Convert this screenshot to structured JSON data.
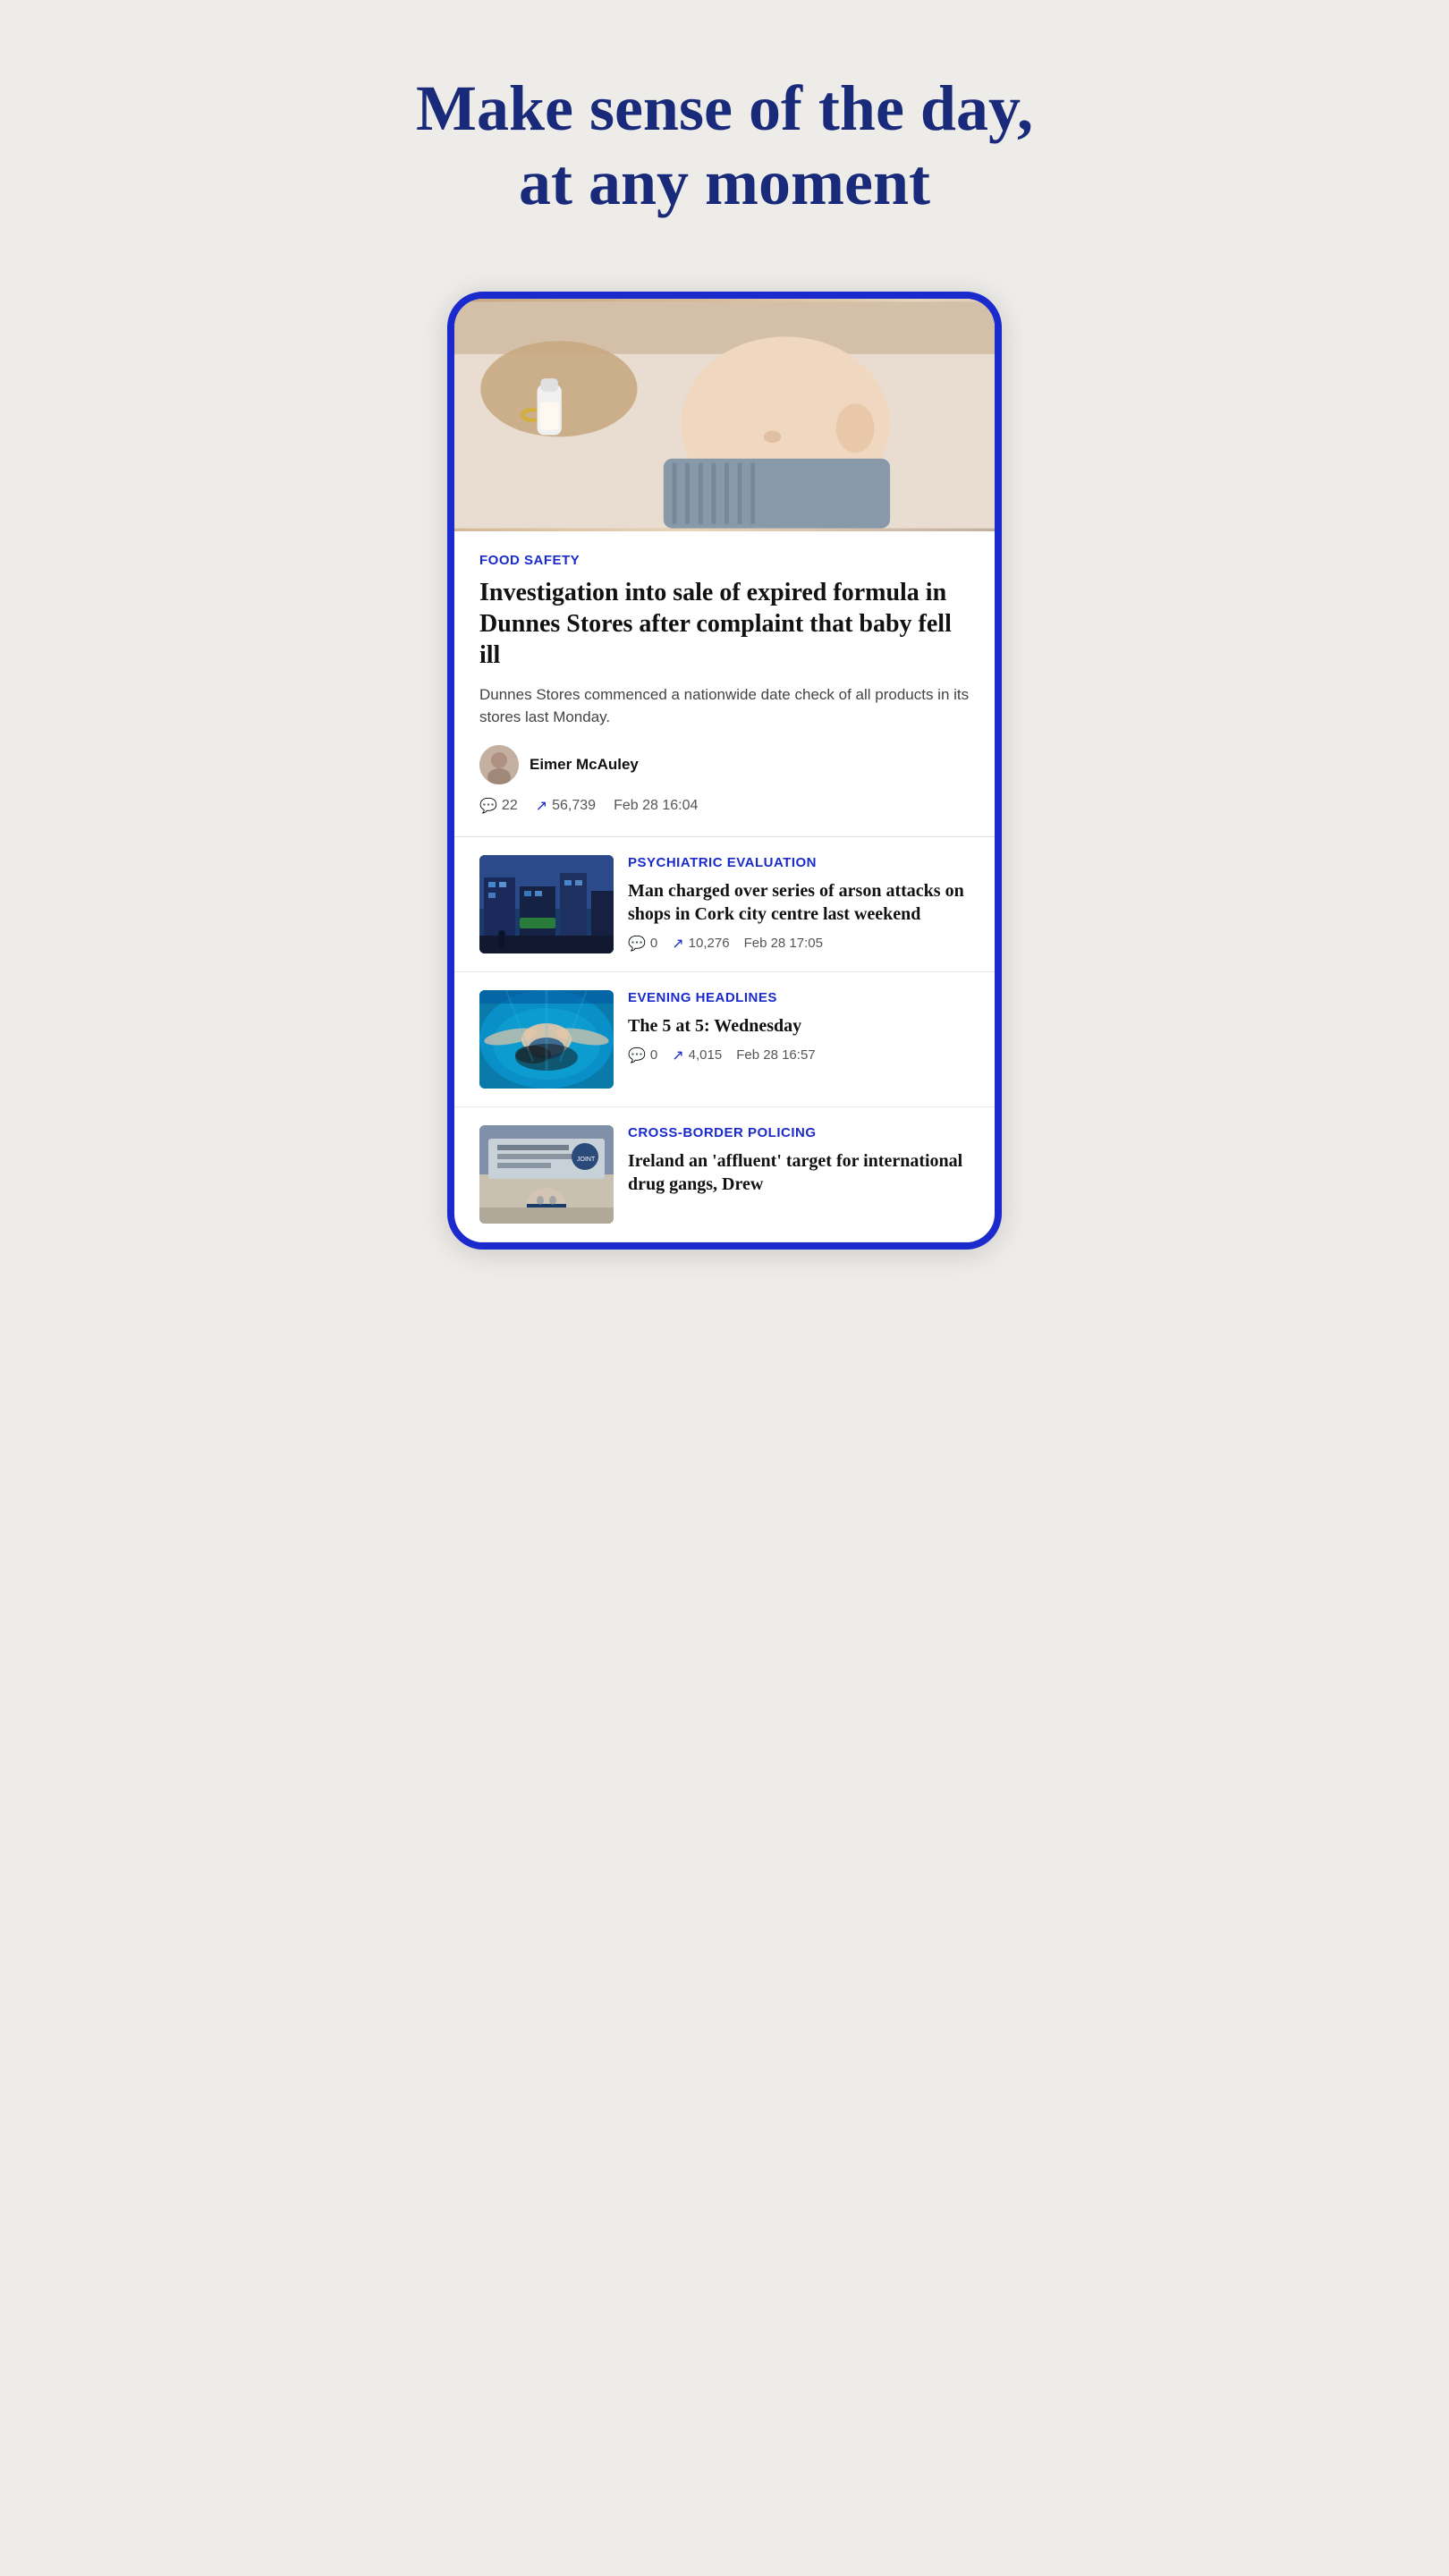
{
  "hero": {
    "headline": "Make sense of the day, at any moment"
  },
  "articles": {
    "featured": {
      "category": "FOOD SAFETY",
      "title": "Investigation into sale of expired formula in Dunnes Stores after complaint that baby fell ill",
      "excerpt": "Dunnes Stores commenced a nationwide date check of all products in its stores last Monday.",
      "author": {
        "name": "Eimer McAuley",
        "avatar_emoji": "👩"
      },
      "comments": "22",
      "trending": "56,739",
      "date": "Feb 28 16:04"
    },
    "list": [
      {
        "category": "PSYCHIATRIC EVALUATION",
        "title": "Man charged over series of arson attacks on shops in Cork city centre last weekend",
        "comments": "0",
        "trending": "10,276",
        "date": "Feb 28 17:05",
        "thumb_type": "arson"
      },
      {
        "category": "EVENING HEADLINES",
        "title": "The 5 at 5: Wednesday",
        "comments": "0",
        "trending": "4,015",
        "date": "Feb 28 16:57",
        "thumb_type": "swimming"
      },
      {
        "category": "CROSS-BORDER POLICING",
        "title": "Ireland an 'affluent' target for international drug gangs, Drew",
        "comments": "",
        "trending": "",
        "date": "",
        "thumb_type": "border"
      }
    ]
  },
  "icons": {
    "comment": "💬",
    "trending": "↗",
    "comment_symbol": "⬜"
  }
}
